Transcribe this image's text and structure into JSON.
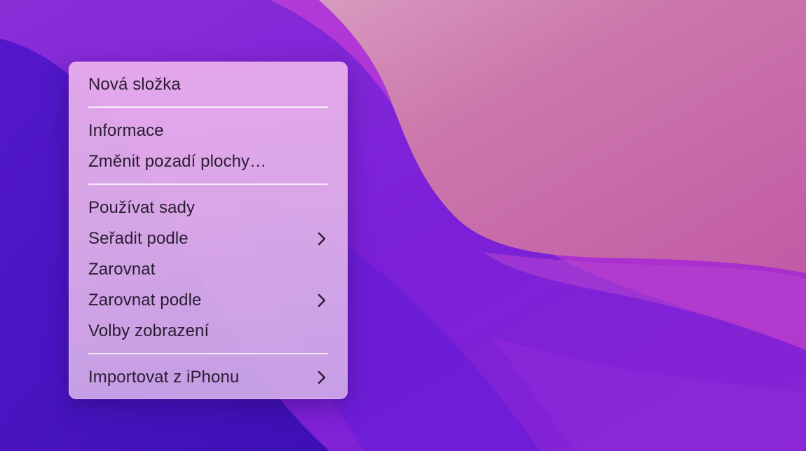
{
  "desktop": {
    "wallpaper": "macOS Monterey",
    "colors": {
      "base": "#7a24d6",
      "deep_violet": "#4a12c4",
      "pink": "#c86aa8",
      "magenta": "#b43ad2"
    }
  },
  "context_menu": {
    "groups": [
      {
        "items": [
          {
            "label": "Nová složka",
            "submenu": false
          }
        ]
      },
      {
        "items": [
          {
            "label": "Informace",
            "submenu": false
          },
          {
            "label": "Změnit pozadí plochy…",
            "submenu": false
          }
        ]
      },
      {
        "items": [
          {
            "label": "Používat sady",
            "submenu": false
          },
          {
            "label": "Seřadit podle",
            "submenu": true
          },
          {
            "label": "Zarovnat",
            "submenu": false
          },
          {
            "label": "Zarovnat podle",
            "submenu": true
          },
          {
            "label": "Volby zobrazení",
            "submenu": false
          }
        ]
      },
      {
        "items": [
          {
            "label": "Importovat z iPhonu",
            "submenu": true
          }
        ]
      }
    ],
    "submenu_icon": "chevron-right-icon",
    "text_color": "#2a1d33"
  }
}
